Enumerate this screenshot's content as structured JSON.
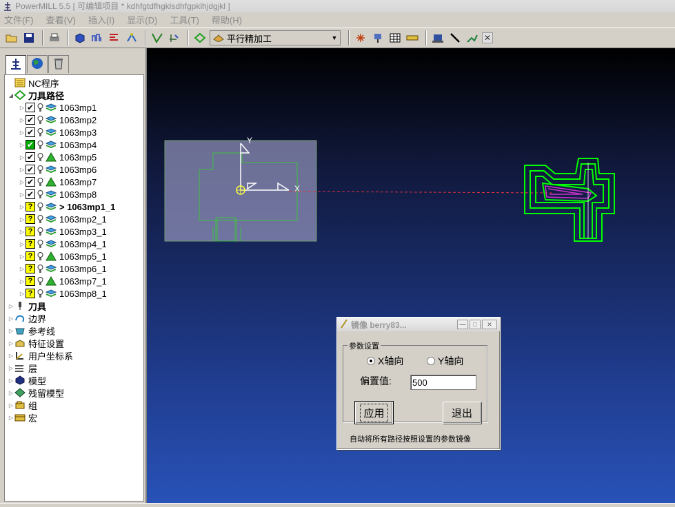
{
  "window": {
    "title": "PowerMILL 5.5   [ 可编辑项目 * kdhfgtdfhgklsdhfgpklhjdgjkl ]"
  },
  "menu": [
    "文件(F)",
    "查看(V)",
    "插入(I)",
    "显示(D)",
    "工具(T)",
    "帮助(H)"
  ],
  "toolbar": {
    "strategy_combo": "平行精加工"
  },
  "tree": {
    "nc_programs": "NC程序",
    "toolpaths": "刀具路径",
    "toolpath_items": [
      {
        "name": "1063mp1",
        "state": "check"
      },
      {
        "name": "1063mp2",
        "state": "check"
      },
      {
        "name": "1063mp3",
        "state": "check"
      },
      {
        "name": "1063mp4",
        "state": "green"
      },
      {
        "name": "1063mp5",
        "state": "check"
      },
      {
        "name": "1063mp6",
        "state": "check"
      },
      {
        "name": "1063mp7",
        "state": "check"
      },
      {
        "name": "1063mp8",
        "state": "check"
      },
      {
        "name": "> 1063mp1_1",
        "state": "question",
        "active": true
      },
      {
        "name": "1063mp2_1",
        "state": "question"
      },
      {
        "name": "1063mp3_1",
        "state": "question"
      },
      {
        "name": "1063mp4_1",
        "state": "question"
      },
      {
        "name": "1063mp5_1",
        "state": "question"
      },
      {
        "name": "1063mp6_1",
        "state": "question"
      },
      {
        "name": "1063mp7_1",
        "state": "question"
      },
      {
        "name": "1063mp8_1",
        "state": "question"
      }
    ],
    "other_items": [
      {
        "label": "刀具",
        "bold": true
      },
      {
        "label": "边界"
      },
      {
        "label": "参考线"
      },
      {
        "label": "特征设置"
      },
      {
        "label": "用户坐标系"
      },
      {
        "label": "层"
      },
      {
        "label": "模型"
      },
      {
        "label": "残留模型"
      },
      {
        "label": "组"
      },
      {
        "label": "宏"
      }
    ]
  },
  "viewport": {
    "axis_x": "X",
    "axis_y": "Y"
  },
  "dialog": {
    "title": "镜像 berry83...",
    "group_label": "参数设置",
    "radio_x": "X轴向",
    "radio_y": "Y轴向",
    "selected_axis": "X",
    "offset_label": "偏置值:",
    "offset_value": "500",
    "apply_button": "应用",
    "exit_button": "退出",
    "footer": "自动将所有路径按照设置的参数镜像"
  },
  "colors": {
    "toolpath_green": "#00ff00",
    "toolpath_magenta": "#cc33cc",
    "viewport_top": "#000000",
    "viewport_bottom": "#2852b8"
  }
}
